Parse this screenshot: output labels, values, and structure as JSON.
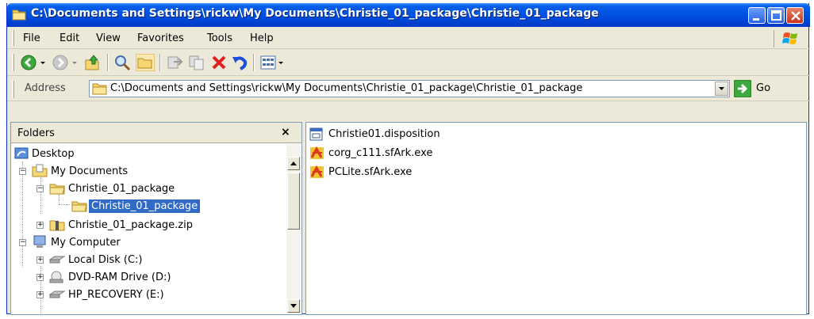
{
  "window": {
    "title": "C:\\Documents and Settings\\rickw\\My Documents\\Christie_01_package\\Christie_01_package"
  },
  "menu": {
    "items": [
      "File",
      "Edit",
      "View",
      "Favorites",
      "Tools",
      "Help"
    ]
  },
  "toolbar": {
    "buttons": [
      "back",
      "forward",
      "up",
      "search",
      "folders",
      "move-to",
      "copy-to",
      "delete",
      "undo",
      "views"
    ]
  },
  "address": {
    "label": "Address",
    "value": "C:\\Documents and Settings\\rickw\\My Documents\\Christie_01_package\\Christie_01_package",
    "go_label": "Go"
  },
  "folders": {
    "title": "Folders",
    "close": "×",
    "tree": [
      {
        "label": "Desktop"
      },
      {
        "label": "My Documents"
      },
      {
        "label": "Christie_01_package"
      },
      {
        "label": "Christie_01_package",
        "selected": true
      },
      {
        "label": "Christie_01_package.zip"
      },
      {
        "label": "My Computer"
      },
      {
        "label": "Local Disk (C:)"
      },
      {
        "label": "DVD-RAM Drive (D:)"
      },
      {
        "label": "HP_RECOVERY (E:)"
      }
    ]
  },
  "files": [
    {
      "name": "Christie01.disposition",
      "icon": "document-icon"
    },
    {
      "name": "corg_c111.sfArk.exe",
      "icon": "sfark-exe-icon"
    },
    {
      "name": "PCLite.sfArk.exe",
      "icon": "sfark-exe-icon"
    }
  ],
  "colors": {
    "titlebar": "#0055e5",
    "selection": "#316ac5",
    "chrome": "#ece9d8"
  }
}
